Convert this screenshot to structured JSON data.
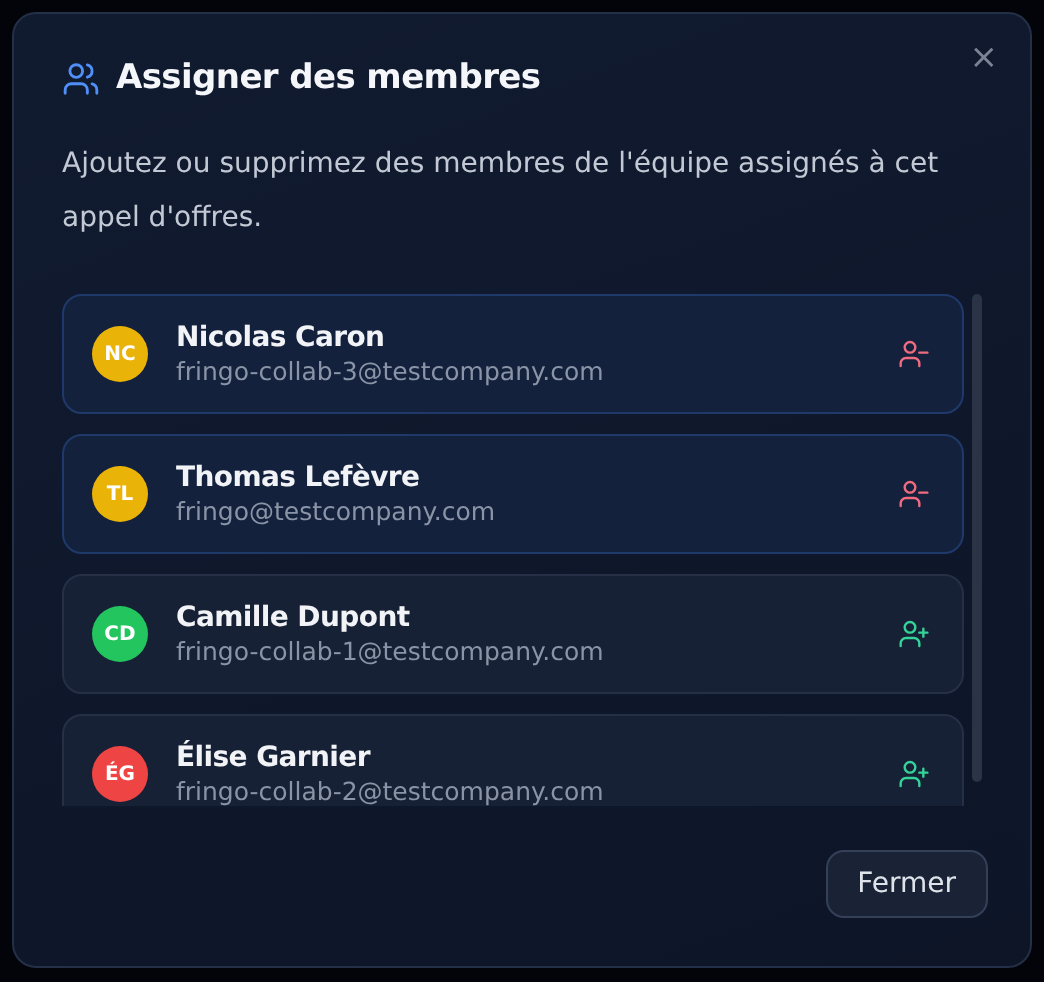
{
  "dialog": {
    "title": "Assigner des membres",
    "description": "Ajoutez ou supprimez des membres de l'équipe assignés à cet appel d'offres.",
    "close_label": "×"
  },
  "members": [
    {
      "initials": "NC",
      "name": "Nicolas Caron",
      "email": "fringo-collab-3@testcompany.com",
      "assigned": true,
      "color": "#eab308"
    },
    {
      "initials": "TL",
      "name": "Thomas Lefèvre",
      "email": "fringo@testcompany.com",
      "assigned": true,
      "color": "#eab308"
    },
    {
      "initials": "CD",
      "name": "Camille Dupont",
      "email": "fringo-collab-1@testcompany.com",
      "assigned": false,
      "color": "#22c55e"
    },
    {
      "initials": "ÉG",
      "name": "Élise Garnier",
      "email": "fringo-collab-2@testcompany.com",
      "assigned": false,
      "color": "#ef4444"
    }
  ],
  "footer": {
    "button": "Fermer"
  }
}
